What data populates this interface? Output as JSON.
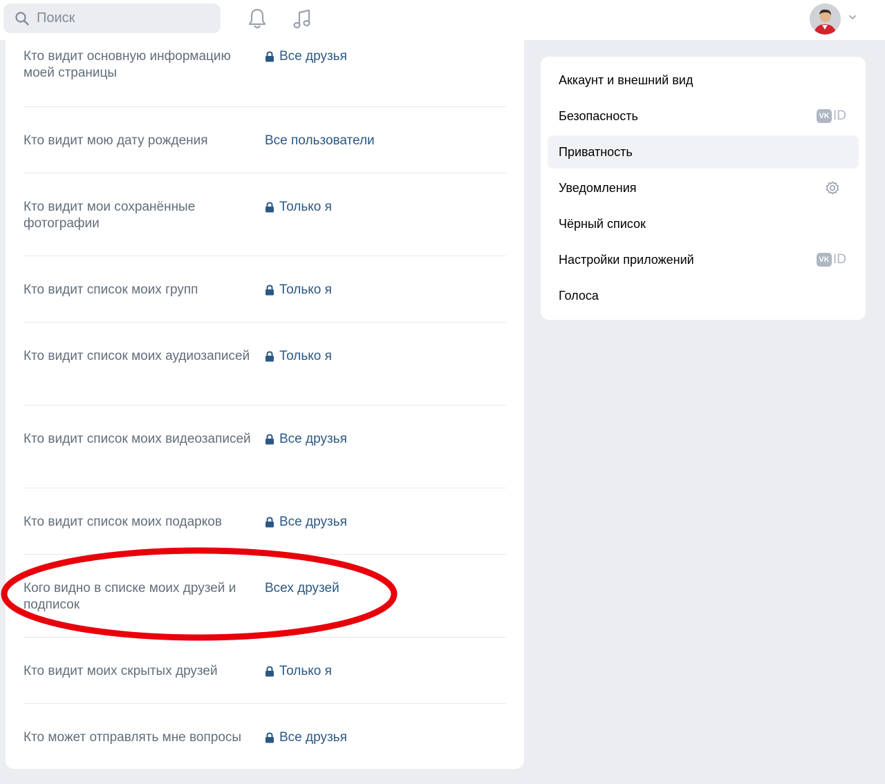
{
  "search": {
    "placeholder": "Поиск"
  },
  "privacy_rows": [
    {
      "label": "Кто видит основную информацию моей страницы",
      "value": "Все друзья",
      "locked": true
    },
    {
      "label": "Кто видит мою дату рождения",
      "value": "Все пользователи",
      "locked": false
    },
    {
      "label": "Кто видит мои сохранённые фотографии",
      "value": "Только я",
      "locked": true
    },
    {
      "label": "Кто видит список моих групп",
      "value": "Только я",
      "locked": true
    },
    {
      "label": "Кто видит список моих аудиозаписей",
      "value": "Только я",
      "locked": true
    },
    {
      "label": "Кто видит список моих видеозаписей",
      "value": "Все друзья",
      "locked": true
    },
    {
      "label": "Кто видит список моих подарков",
      "value": "Все друзья",
      "locked": true
    },
    {
      "label": "Кого видно в списке моих друзей и подписок",
      "value": "Всех друзей",
      "locked": false
    },
    {
      "label": "Кто видит моих скрытых друзей",
      "value": "Только я",
      "locked": true
    },
    {
      "label": "Кто может отправлять мне вопросы",
      "value": "Все друзья",
      "locked": true
    }
  ],
  "settings_menu": [
    {
      "label": "Аккаунт и внешний вид",
      "badge": ""
    },
    {
      "label": "Безопасность",
      "badge": "vk-id"
    },
    {
      "label": "Приватность",
      "badge": "",
      "active": true
    },
    {
      "label": "Уведомления",
      "badge": "gear"
    },
    {
      "label": "Чёрный список",
      "badge": ""
    },
    {
      "label": "Настройки приложений",
      "badge": "vk-id"
    },
    {
      "label": "Голоса",
      "badge": ""
    }
  ],
  "vk_id": {
    "logo": "VK",
    "text": "ID"
  },
  "colors": {
    "link": "#2a5885",
    "label": "#626d7a",
    "annotation": "#e8000b",
    "page_bg": "#ebedf0"
  }
}
